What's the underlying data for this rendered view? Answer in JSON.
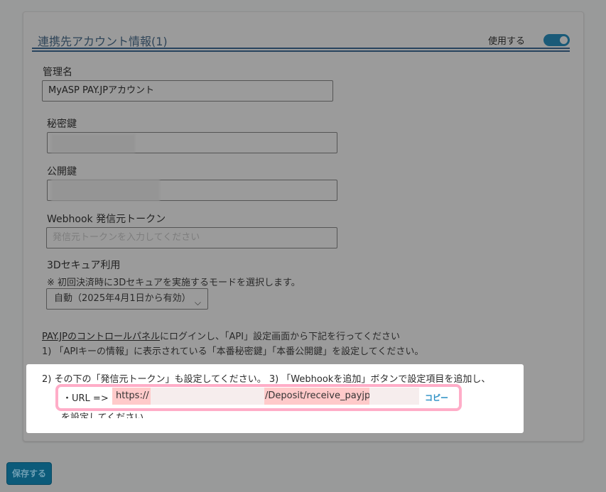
{
  "section": {
    "title": "連携先アカウント情報(1)",
    "toggle_label": "使用する",
    "toggle_on": true
  },
  "fields": {
    "name_label": "管理名",
    "name_value": "MyASP PAY.JPアカウント",
    "secret_label": "秘密鍵",
    "public_label": "公開鍵",
    "webhook_label": "Webhook 発信元トークン",
    "webhook_placeholder": "発信元トークンを入力してください",
    "secure_label": "3Dセキュア利用",
    "secure_note": "※ 初回決済時に3Dセキュアを実施するモードを選択します。",
    "secure_value": "自動（2025年4月1日から有効）"
  },
  "instructions": {
    "link": "PAY.JPのコントロールパネル",
    "line0_rest": "にログインし、「API」設定画面から下記を行ってください",
    "line1": "1) 「APIキーの情報」に表示されている「本番秘密鍵」「本番公開鍵」を設定してください。",
    "line2": "2) その下の「発信元トークン」も設定してください。 3) 「Webhookを追加」ボタンで設定項目を追加し、",
    "url_label": "・URL =>",
    "url_prefix": "https://",
    "url_path": "/Deposit/receive_payjp",
    "copy": "コピー",
    "line3": "を設定してください"
  },
  "footer": {
    "save": "保存する"
  }
}
